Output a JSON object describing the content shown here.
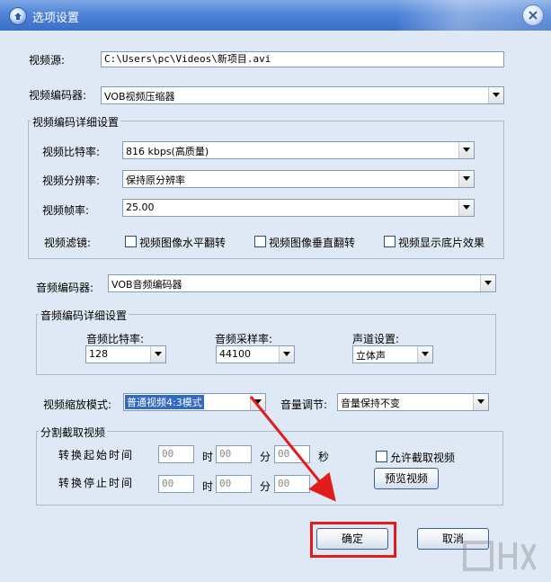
{
  "window": {
    "title": "选项设置"
  },
  "video_source": {
    "label": "视频源:",
    "value": "C:\\Users\\pc\\Videos\\新项目.avi"
  },
  "video_encoder": {
    "label": "视频编码器:",
    "value": "VOB视频压缩器"
  },
  "video_detail": {
    "legend": "视频编码详细设置",
    "bitrate": {
      "label": "视频比特率:",
      "value": "816 kbps(高质量)"
    },
    "resolution": {
      "label": "视频分辨率:",
      "value": "保持原分辨率"
    },
    "framerate": {
      "label": "视频帧率:",
      "value": "25.00"
    },
    "filter": {
      "label": "视频滤镜:",
      "options": [
        "视频图像水平翻转",
        "视频图像垂直翻转",
        "视频显示底片效果"
      ]
    }
  },
  "audio_encoder": {
    "label": "音频编码器:",
    "value": "VOB音频编码器"
  },
  "audio_detail": {
    "legend": "音频编码详细设置",
    "bitrate": {
      "label": "音频比特率:",
      "value": "128"
    },
    "samplerate": {
      "label": "音频采样率:",
      "value": "44100"
    },
    "channel": {
      "label": "声道设置:",
      "value": "立体声"
    }
  },
  "scale_mode": {
    "label": "视频缩放模式:",
    "value": "普通视频4:3模式"
  },
  "volume": {
    "label": "音量调节:",
    "value": "音量保持不变"
  },
  "split": {
    "legend": "分割截取视频",
    "start_label": "转换起始时间",
    "stop_label": "转换停止时间",
    "hour_unit": "时",
    "minute_unit": "分",
    "second_unit": "秒",
    "start": {
      "h": "00",
      "m": "00",
      "s": "00"
    },
    "stop": {
      "h": "00",
      "m": "00",
      "s": "00"
    },
    "allow_label": "允许截取视频",
    "preview_label": "预览视频"
  },
  "buttons": {
    "ok": "确定",
    "cancel": "取消"
  },
  "colors": {
    "title_bar": "#4f83d6",
    "panel": "#dfe9f5",
    "highlight": "#316ac5",
    "annotation": "#e21b1b"
  }
}
